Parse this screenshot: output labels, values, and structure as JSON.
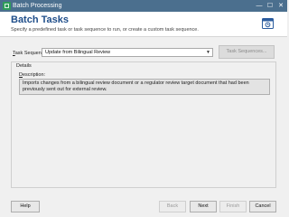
{
  "window": {
    "title": "Batch Processing",
    "controls": {
      "minimize": "—",
      "maximize": "☐",
      "close": "✕"
    }
  },
  "header": {
    "title": "Batch Tasks",
    "subtitle": "Specify a predefined task or task sequence to run, or create a custom task sequence.",
    "icon": "batch-tasks-calendar-icon"
  },
  "task_sequence": {
    "label_underlined": "T",
    "label_rest": "ask Sequence:",
    "selected_value": "Update from Bilingual Review",
    "button_label": "Task Sequences..."
  },
  "details": {
    "group_label": "Details",
    "description_label_underlined": "D",
    "description_label_rest": "escription:",
    "description_text": "Imports changes from a bilingual review document or a regulator review target document that had been previously sent out for external review."
  },
  "footer": {
    "help": "Help",
    "back": "Back",
    "next": "Next",
    "finish": "Finish",
    "cancel": "Cancel"
  },
  "colors": {
    "titlebar": "#4b6f8e",
    "header_title": "#1f4e8a",
    "background": "#f0f0f0"
  }
}
